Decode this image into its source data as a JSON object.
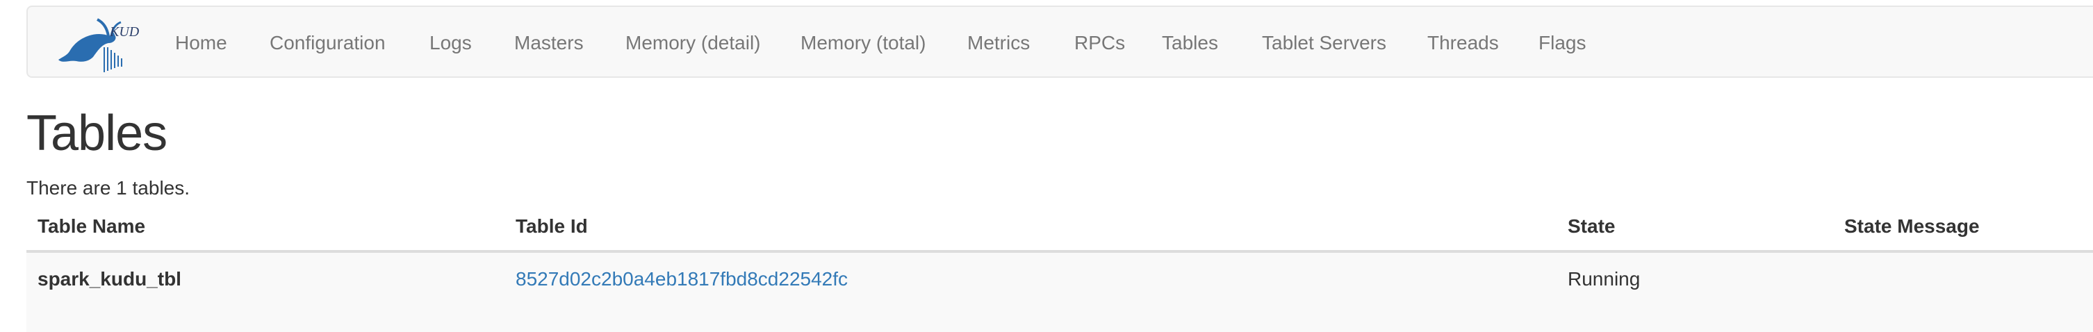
{
  "navbar": {
    "brand_alt": "KUDU",
    "items": [
      {
        "label": "Home"
      },
      {
        "label": "Configuration"
      },
      {
        "label": "Logs"
      },
      {
        "label": "Masters"
      },
      {
        "label": "Memory (detail)"
      },
      {
        "label": "Memory (total)"
      },
      {
        "label": "Metrics"
      },
      {
        "label": "RPCs"
      },
      {
        "label": "Tables"
      },
      {
        "label": "Tablet Servers"
      },
      {
        "label": "Threads"
      },
      {
        "label": "Flags"
      }
    ]
  },
  "page": {
    "title": "Tables",
    "summary": "There are 1 tables."
  },
  "table": {
    "columns": [
      "Table Name",
      "Table Id",
      "State",
      "State Message"
    ],
    "rows": [
      {
        "name": "spark_kudu_tbl",
        "id": "8527d02c2b0a4eb1817fbd8cd22542fc",
        "state": "Running",
        "state_message": ""
      }
    ]
  },
  "colors": {
    "link": "#337ab7",
    "nav_text": "#777777",
    "navbar_bg": "#f8f8f8",
    "logo_blue": "#2a6db0"
  }
}
